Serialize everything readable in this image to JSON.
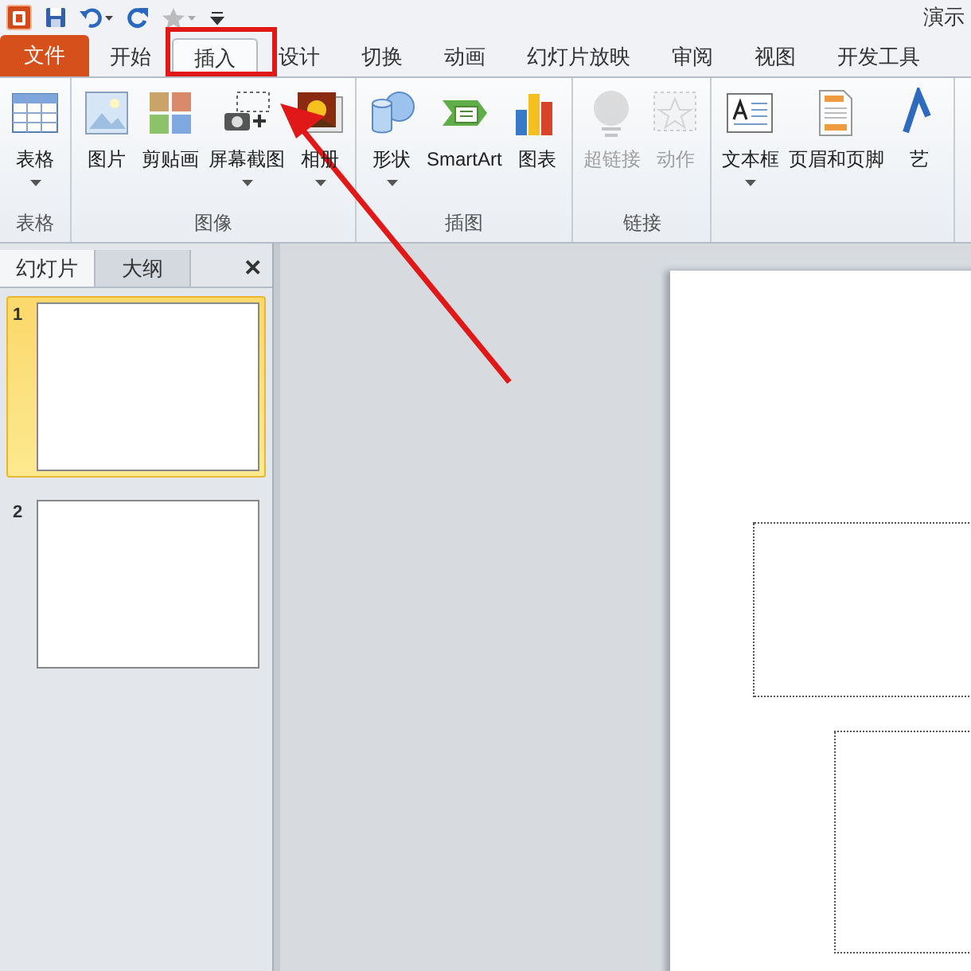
{
  "window": {
    "title": "演示"
  },
  "quick_access": [
    {
      "kind": "save"
    },
    {
      "kind": "undo"
    },
    {
      "kind": "redo"
    },
    {
      "kind": "star"
    }
  ],
  "tabs": [
    {
      "label": "文件",
      "kind": "file",
      "selected": false
    },
    {
      "label": "开始",
      "kind": "tab",
      "selected": false
    },
    {
      "label": "插入",
      "kind": "tab",
      "selected": true
    },
    {
      "label": "设计",
      "kind": "tab",
      "selected": false
    },
    {
      "label": "切换",
      "kind": "tab",
      "selected": false
    },
    {
      "label": "动画",
      "kind": "tab",
      "selected": false
    },
    {
      "label": "幻灯片放映",
      "kind": "tab",
      "selected": false
    },
    {
      "label": "审阅",
      "kind": "tab",
      "selected": false
    },
    {
      "label": "视图",
      "kind": "tab",
      "selected": false
    },
    {
      "label": "开发工具",
      "kind": "tab",
      "selected": false
    }
  ],
  "ribbon_groups": [
    {
      "label": "表格",
      "buttons": [
        {
          "label": "表格",
          "kind": "table",
          "dropdown": true,
          "disabled": false
        }
      ]
    },
    {
      "label": "图像",
      "buttons": [
        {
          "label": "图片",
          "kind": "picture",
          "dropdown": false,
          "disabled": false
        },
        {
          "label": "剪贴画",
          "kind": "clipart",
          "dropdown": false,
          "disabled": false
        },
        {
          "label": "屏幕截图",
          "kind": "camera",
          "dropdown": true,
          "disabled": false
        },
        {
          "label": "相册",
          "kind": "album",
          "dropdown": true,
          "disabled": false
        }
      ]
    },
    {
      "label": "插图",
      "buttons": [
        {
          "label": "形状",
          "kind": "shapes",
          "dropdown": true,
          "disabled": false
        },
        {
          "label": "SmartArt",
          "kind": "smartart",
          "dropdown": false,
          "disabled": false
        },
        {
          "label": "图表",
          "kind": "chart",
          "dropdown": false,
          "disabled": false
        }
      ]
    },
    {
      "label": "链接",
      "buttons": [
        {
          "label": "超链接",
          "kind": "globe",
          "dropdown": false,
          "disabled": true
        },
        {
          "label": "动作",
          "kind": "action",
          "dropdown": false,
          "disabled": true
        }
      ]
    },
    {
      "buttons": [
        {
          "label": "文本框",
          "kind": "textbox",
          "dropdown": true,
          "disabled": false
        },
        {
          "label": "页眉和页脚",
          "kind": "header",
          "dropdown": false,
          "disabled": false
        },
        {
          "label": "艺",
          "kind": "wordart",
          "dropdown": false,
          "disabled": false
        }
      ]
    }
  ],
  "pane_tabs": [
    {
      "label": "幻灯片",
      "selected": true
    },
    {
      "label": "大纲",
      "selected": false
    }
  ],
  "pane_close": "✕",
  "slides": [
    {
      "number": "1",
      "selected": true
    },
    {
      "number": "2",
      "selected": false
    }
  ]
}
